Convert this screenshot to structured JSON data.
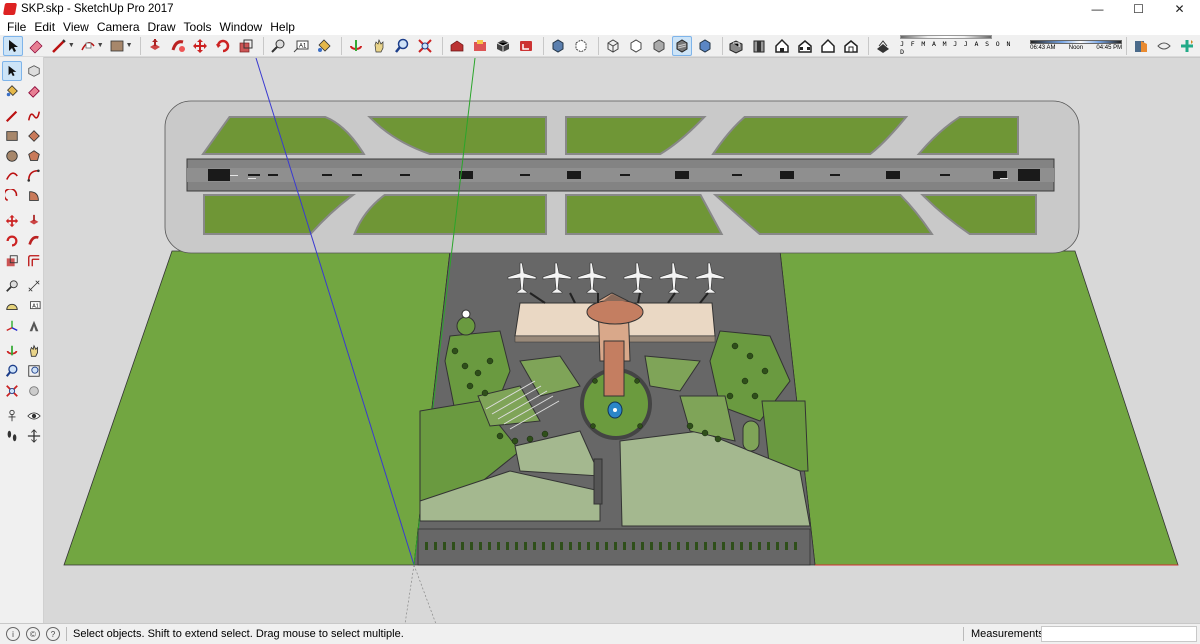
{
  "window": {
    "title": "SKP.skp - SketchUp Pro 2017",
    "minimize_glyph": "—",
    "maximize_glyph": "☐",
    "close_glyph": "✕"
  },
  "menu": [
    "File",
    "Edit",
    "View",
    "Camera",
    "Draw",
    "Tools",
    "Window",
    "Help"
  ],
  "shadow_settings": {
    "months": "J F M A M J J A S O N D",
    "time_start": "06:43 AM",
    "time_mid": "Noon",
    "time_end": "04:45 PM"
  },
  "status": {
    "hint": "Select objects. Shift to extend select. Drag mouse to select multiple.",
    "measurements_label": "Measurements",
    "measurements_value": ""
  },
  "toolbar_icons": [
    "select-icon",
    "eraser-icon",
    "line-icon",
    "arc-icon",
    "rectangle-icon",
    "push-pull-icon",
    "follow-me-icon",
    "move-icon",
    "rotate-icon",
    "scale-icon",
    "tape-measure-icon",
    "text-icon",
    "paint-bucket-icon",
    "orbit-icon",
    "pan-icon",
    "zoom-icon",
    "zoom-extents-icon",
    "warehouse-icon",
    "extension-warehouse-icon",
    "components-icon",
    "layout-icon",
    "xray-icon",
    "back-edges-icon",
    "wireframe-icon",
    "hidden-line-icon",
    "shaded-icon",
    "shaded-textures-icon",
    "monochrome-icon",
    "iso-view-icon",
    "top-view-icon",
    "front-view-icon",
    "right-view-icon",
    "back-view-icon",
    "left-view-icon",
    "shadows-icon",
    "section-plane-icon",
    "section-display-icon",
    "geo-location-icon"
  ],
  "colors": {
    "grass": "#72a641",
    "runway_shoulder": "#c9c9c9",
    "runway_surface": "#858585",
    "apron": "#6b6b6b",
    "terminal_roof": "#ead8c4",
    "green_axis": "#2aa52a",
    "blue_axis": "#3a3ad0",
    "red_axis": "#d03030"
  }
}
